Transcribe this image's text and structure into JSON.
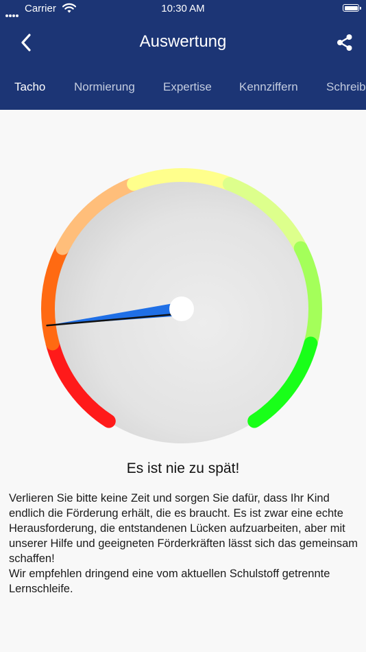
{
  "status_bar": {
    "carrier": "Carrier",
    "time": "10:30 AM",
    "icons": [
      "signal-icon",
      "wifi-icon",
      "battery-icon"
    ]
  },
  "nav": {
    "title": "Auswertung",
    "back_icon": "chevron-left-icon",
    "share_icon": "share-icon"
  },
  "tabs": [
    {
      "label": "Tacho",
      "active": true
    },
    {
      "label": "Normierung",
      "active": false
    },
    {
      "label": "Expertise",
      "active": false
    },
    {
      "label": "Kennziffern",
      "active": false
    },
    {
      "label": "Schreib",
      "active": false
    }
  ],
  "gauge": {
    "value_fraction": 0.17,
    "scale_colors": [
      "#ff1a1a",
      "#ff6a12",
      "#ffbe7a",
      "#ffff8c",
      "#ddff8c",
      "#a4ff5a",
      "#19ff19"
    ],
    "needle_color": "#1f6fe6",
    "dial_color": "#e2e2e2"
  },
  "result": {
    "headline": "Es ist nie zu spät!",
    "paragraphs": [
      "Verlieren Sie bitte keine Zeit und sorgen Sie dafür, dass Ihr Kind endlich die Förderung erhält, die es braucht. Es ist zwar eine echte Herausforderung, die entstandenen Lücken aufzuarbeiten, aber mit unserer Hilfe und geeigneten Förderkräften lässt sich das gemeinsam schaffen!",
      "Wir empfehlen dringend eine vom aktuellen Schulstoff getrennte Lernschleife."
    ]
  }
}
